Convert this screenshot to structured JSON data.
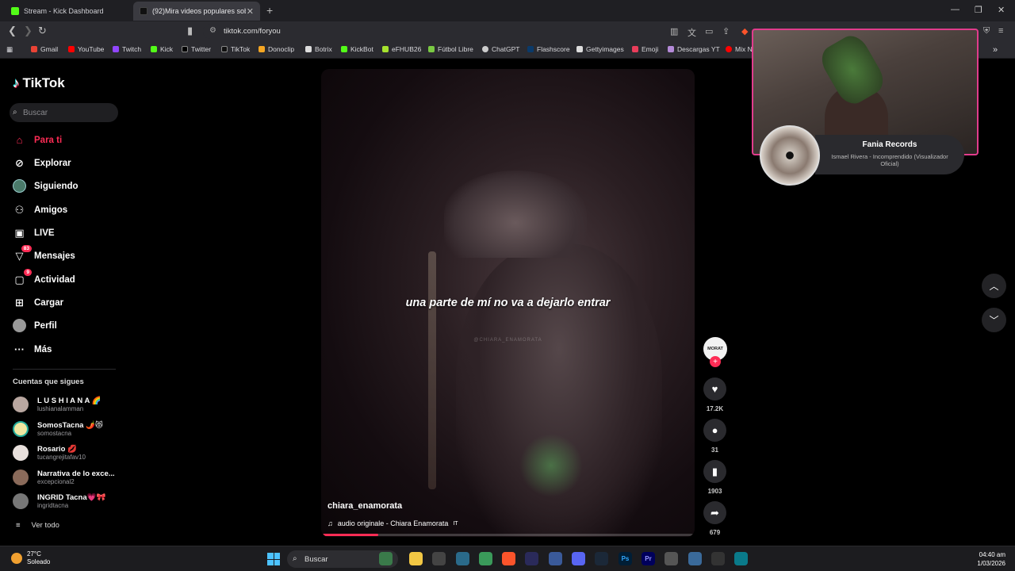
{
  "browser": {
    "tabs": [
      {
        "label": "Stream - Kick Dashboard",
        "active": false
      },
      {
        "label": "(92)Mira videos populares sob",
        "active": true
      }
    ],
    "url": "tiktok.com/foryou",
    "bookmarks": [
      "Gmail",
      "YouTube",
      "Twitch",
      "Kick",
      "Twitter",
      "TikTok",
      "Donoclip",
      "Botrix",
      "KickBot",
      "eFHUB26",
      "Fútbol Libre",
      "ChatGPT",
      "Flashscore",
      "Gettyimages",
      "Emoji",
      "Descargas YT",
      "Mix N"
    ]
  },
  "sidebar": {
    "logo": "TikTok",
    "search_placeholder": "Buscar",
    "nav": [
      {
        "label": "Para ti",
        "icon": "home-icon",
        "active": true
      },
      {
        "label": "Explorar",
        "icon": "compass-icon"
      },
      {
        "label": "Siguiendo",
        "icon": "following-avatar-icon"
      },
      {
        "label": "Amigos",
        "icon": "friends-icon"
      },
      {
        "label": "LIVE",
        "icon": "live-tv-icon"
      },
      {
        "label": "Mensajes",
        "icon": "inbox-icon",
        "badge": "83"
      },
      {
        "label": "Actividad",
        "icon": "activity-icon",
        "badge": "9"
      },
      {
        "label": "Cargar",
        "icon": "upload-icon"
      },
      {
        "label": "Perfil",
        "icon": "profile-avatar-icon"
      },
      {
        "label": "Más",
        "icon": "more-dots-icon"
      }
    ],
    "following_title": "Cuentas que sigues",
    "accounts": [
      {
        "name": "L U S H I A N A 🌈",
        "handle": "lushianalamman"
      },
      {
        "name": "SomosTacna 🌶️😻",
        "handle": "somostacna"
      },
      {
        "name": "Rosario 💋",
        "handle": "tucangrejitafav10"
      },
      {
        "name": "Narrativa de lo exce...",
        "handle": "excepcional2"
      },
      {
        "name": "INGRID Tacna💗🎀",
        "handle": "ingridtacna"
      }
    ],
    "see_all": "Ver todo"
  },
  "video": {
    "subtitle": "una parte de mí no va a dejarlo entrar",
    "watermark": "@CHIARA_ENAMORATA",
    "author": "chiara_enamorata",
    "music": "audio originale - Chiara Enamorata",
    "progress": 0.15,
    "creator_avatar_text": "MORAT"
  },
  "actions": {
    "likes": "17.2K",
    "comments": "31",
    "saves": "1903",
    "shares": "679"
  },
  "overlay": {
    "artist": "Fania Records",
    "track": "Ismael Rivera - Incomprendido (Visualizador Oficial)"
  },
  "taskbar": {
    "temp": "27°C",
    "weather": "Soleado",
    "search": "Buscar",
    "time": "04:40 am",
    "date": "1/03/2026"
  }
}
